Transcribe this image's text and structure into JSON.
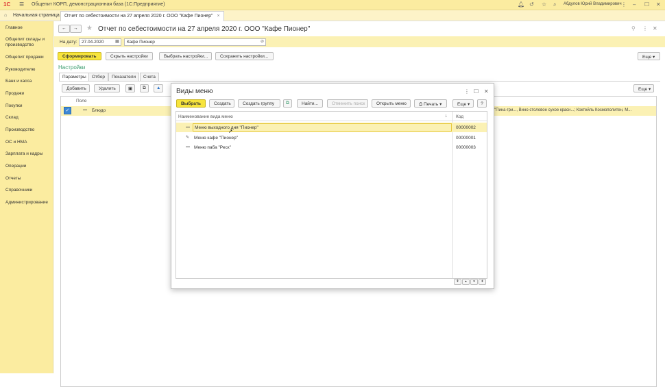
{
  "app": {
    "logo": "1С",
    "title": "Общепит КОРП, демонстрационная база  (1С:Предприятие)",
    "user": "Абдулов Юрий Владимирович"
  },
  "tabs": [
    {
      "label": "Начальная страница"
    },
    {
      "label": "Отчет по себестоимости на 27 апреля 2020 г. ООО \"Кафе Пионер\""
    }
  ],
  "sidebar": {
    "items": [
      {
        "label": "Главное"
      },
      {
        "label": "Общепит склады и производство"
      },
      {
        "label": "Общепит продажи"
      },
      {
        "label": "Руководителю"
      },
      {
        "label": "Банк и касса"
      },
      {
        "label": "Продажи"
      },
      {
        "label": "Покупки"
      },
      {
        "label": "Склад"
      },
      {
        "label": "Производство"
      },
      {
        "label": "ОС и НМА"
      },
      {
        "label": "Зарплата и кадры"
      },
      {
        "label": "Операции"
      },
      {
        "label": "Отчеты"
      },
      {
        "label": "Справочники"
      },
      {
        "label": "Администрирование"
      }
    ]
  },
  "report": {
    "title": "Отчет по себестоимости на 27 апреля 2020 г. ООО \"Кафе Пионер\"",
    "date_label": "На дату:",
    "date_value": "27.04.2020",
    "org_value": "Кафе Пионер",
    "buttons": {
      "generate": "Сформировать",
      "hide_settings": "Скрыть настройки",
      "select_settings": "Выбрать настройки...",
      "save_settings": "Сохранить настройки...",
      "more": "Еще"
    },
    "settings_link": "Настройки",
    "subtabs": [
      "Параметры",
      "Отбор",
      "Показатели",
      "Счета"
    ],
    "filter_buttons": {
      "add": "Добавить",
      "delete": "Удалить",
      "more": "Еще"
    },
    "grid": {
      "column_field": "Поле",
      "row_value": "Блюдо",
      "row_extra": "\"Пина-гри..., Вино столовое сухое красн...; Коктейль Космополитен, М..."
    }
  },
  "dialog": {
    "title": "Виды меню",
    "toolbar": {
      "select": "Выбрать",
      "create": "Создать",
      "create_group": "Создать группу",
      "find": "Найти...",
      "cancel_search": "Отменить поиск",
      "open_menu": "Открыть меню",
      "print": "Печать",
      "more": "Еще",
      "help": "?"
    },
    "columns": {
      "name": "Наименование вида меню",
      "code": "Код"
    },
    "rows": [
      {
        "name": "Меню выходного дня \"Пионер\"",
        "code": "00000002"
      },
      {
        "name": "Меню кафе \"Пионер\"",
        "code": "00000001"
      },
      {
        "name": "Меню паба \"Реск\"",
        "code": "00000003"
      }
    ]
  },
  "colors": {
    "accent": "#f7e43c",
    "sidebar": "#fbeca0",
    "link": "#3a9c6d"
  }
}
